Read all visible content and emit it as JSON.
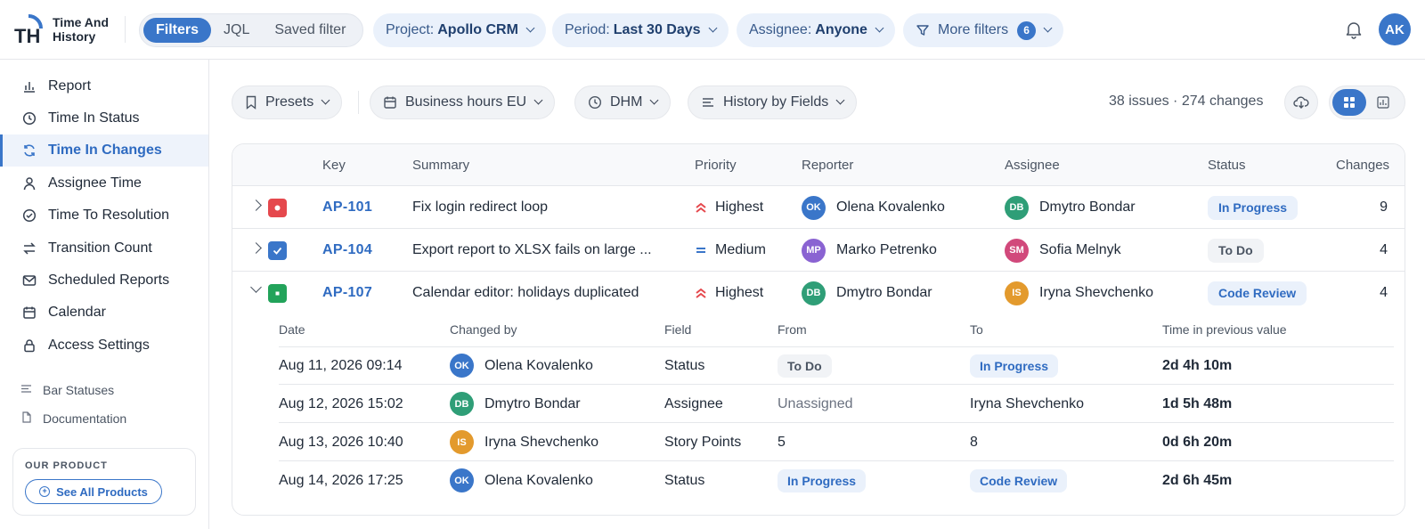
{
  "app": {
    "name_line1": "Time And",
    "name_line2": "History",
    "logo_letters": "TH"
  },
  "header": {
    "modes": [
      "Filters",
      "JQL",
      "Saved filter"
    ],
    "project_label": "Project:",
    "project_value": "Apollo CRM",
    "period_label": "Period:",
    "period_value": "Last 30 Days",
    "assignee_label": "Assignee:",
    "assignee_value": "Anyone",
    "more_filters": "More filters",
    "more_filters_count": "6",
    "user_initials": "AK"
  },
  "sidebar": {
    "items": [
      {
        "label": "Report",
        "icon": "bar-chart-icon"
      },
      {
        "label": "Time In Status",
        "icon": "clock-icon"
      },
      {
        "label": "Time In Changes",
        "icon": "refresh-icon"
      },
      {
        "label": "Assignee Time",
        "icon": "user-icon"
      },
      {
        "label": "Time To Resolution",
        "icon": "check-circle-icon"
      },
      {
        "label": "Transition Count",
        "icon": "swap-icon"
      },
      {
        "label": "Scheduled Reports",
        "icon": "mail-icon"
      },
      {
        "label": "Calendar",
        "icon": "calendar-icon"
      },
      {
        "label": "Access Settings",
        "icon": "lock-icon"
      }
    ],
    "active": "Time In Changes",
    "links": [
      {
        "label": "Bar Statuses",
        "icon": "lines-icon"
      },
      {
        "label": "Documentation",
        "icon": "document-icon"
      }
    ],
    "product_label": "OUR PRODUCT",
    "product_button": "See All Products"
  },
  "toolbar": {
    "presets": "Presets",
    "calendar": "Business hours EU",
    "format": "DHM",
    "mode": "History by Fields",
    "summary": "38 issues · 274 changes"
  },
  "table": {
    "columns": [
      "Key",
      "Summary",
      "Priority",
      "Reporter",
      "Assignee",
      "Status",
      "Changes"
    ],
    "rows": [
      {
        "key": "AP-101",
        "summary": "Fix login redirect loop",
        "priority": "Highest",
        "reporter": "Olena Kovalenko",
        "reporter_initials": "OK",
        "assignee": "Dmytro Bondar",
        "assignee_initials": "DB",
        "status": "In Progress",
        "changes": "9",
        "type": "bug"
      },
      {
        "key": "AP-104",
        "summary": "Export report to XLSX fails on large ...",
        "priority": "Medium",
        "reporter": "Marko Petrenko",
        "reporter_initials": "MP",
        "assignee": "Sofia Melnyk",
        "assignee_initials": "SM",
        "status": "To Do",
        "changes": "4",
        "type": "task"
      },
      {
        "key": "AP-107",
        "summary": "Calendar editor: holidays duplicated",
        "priority": "Highest",
        "reporter": "Dmytro Bondar",
        "reporter_initials": "DB",
        "assignee": "Iryna Shevchenko",
        "assignee_initials": "IS",
        "status": "Code Review",
        "changes": "4",
        "type": "story"
      }
    ]
  },
  "history": {
    "columns": [
      "Date",
      "Changed by",
      "Field",
      "From",
      "To",
      "Time in previous value"
    ],
    "rows": [
      {
        "date": "Aug 11, 2026 09:14",
        "by": "Olena Kovalenko",
        "by_initials": "OK",
        "field": "Status",
        "from": "To Do",
        "to": "In Progress",
        "time": "2d 4h 10m"
      },
      {
        "date": "Aug 12, 2026 15:02",
        "by": "Dmytro Bondar",
        "by_initials": "DB",
        "field": "Assignee",
        "from": "Unassigned",
        "to": "Iryna Shevchenko",
        "time": "1d 5h 48m"
      },
      {
        "date": "Aug 13, 2026 10:40",
        "by": "Iryna Shevchenko",
        "by_initials": "IS",
        "field": "Story Points",
        "from": "5",
        "to": "8",
        "time": "0d 6h 20m"
      },
      {
        "date": "Aug 14, 2026 17:25",
        "by": "Olena Kovalenko",
        "by_initials": "OK",
        "field": "Status",
        "from": "In Progress",
        "to": "Code Review",
        "time": "2d 6h 45m"
      }
    ]
  },
  "colors": {
    "accent": "#3a76c9",
    "bug": "#e5484d",
    "task": "#3a76c9",
    "story": "#22a35a",
    "av_OK": "#3a76c9",
    "av_DB": "#2f9e77",
    "av_MP": "#8a63d2",
    "av_SM": "#d1497b",
    "av_IS": "#e39a2d"
  }
}
